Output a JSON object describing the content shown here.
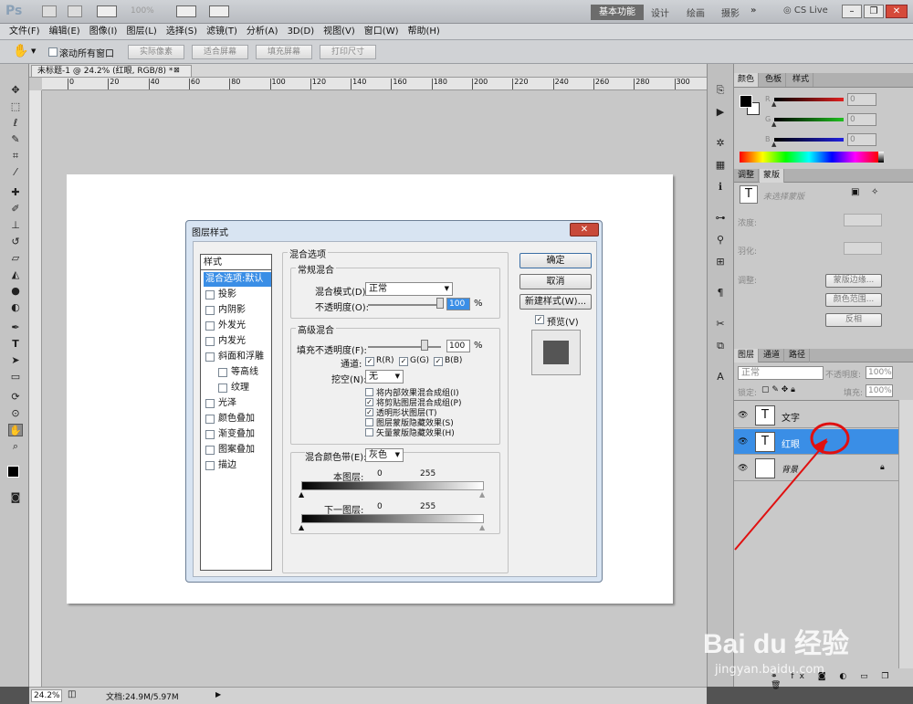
{
  "app": {
    "logo": "Ps",
    "zoom_display": "100%",
    "workspaces": [
      "基本功能",
      "设计",
      "绘画",
      "摄影"
    ],
    "cslive": "CS Live"
  },
  "menu": [
    "文件(F)",
    "编辑(E)",
    "图像(I)",
    "图层(L)",
    "选择(S)",
    "滤镜(T)",
    "分析(A)",
    "3D(D)",
    "视图(V)",
    "窗口(W)",
    "帮助(H)"
  ],
  "options": {
    "scroll_all": "滚动所有窗口",
    "btn1": "实际像素",
    "btn2": "适合屏幕",
    "btn3": "填充屏幕",
    "btn4": "打印尺寸"
  },
  "doc": {
    "tab": "未标题-1 @ 24.2% (红眼, RGB/8) *",
    "ruler": [
      "0",
      "20",
      "40",
      "60",
      "80",
      "100",
      "120",
      "140",
      "160",
      "180",
      "200",
      "220",
      "240",
      "260",
      "280",
      "300"
    ],
    "zoom": "24.2%",
    "status": "文档:24.9M/5.97M"
  },
  "dialog": {
    "title": "图层样式",
    "styles_header": "样式",
    "styles": [
      {
        "label": "混合选项:默认",
        "selected": true,
        "checkbox": false,
        "indent": false
      },
      {
        "label": "投影",
        "checkbox": true,
        "indent": false
      },
      {
        "label": "内阴影",
        "checkbox": true,
        "indent": false
      },
      {
        "label": "外发光",
        "checkbox": true,
        "indent": false
      },
      {
        "label": "内发光",
        "checkbox": true,
        "indent": false
      },
      {
        "label": "斜面和浮雕",
        "checkbox": true,
        "indent": false
      },
      {
        "label": "等高线",
        "checkbox": true,
        "indent": true
      },
      {
        "label": "纹理",
        "checkbox": true,
        "indent": true
      },
      {
        "label": "光泽",
        "checkbox": true,
        "indent": false
      },
      {
        "label": "颜色叠加",
        "checkbox": true,
        "indent": false
      },
      {
        "label": "渐变叠加",
        "checkbox": true,
        "indent": false
      },
      {
        "label": "图案叠加",
        "checkbox": true,
        "indent": false
      },
      {
        "label": "描边",
        "checkbox": true,
        "indent": false
      }
    ],
    "blend_options": "混合选项",
    "general": "常规混合",
    "blend_mode_label": "混合模式(D):",
    "blend_mode": "正常",
    "opacity_label": "不透明度(O):",
    "opacity": "100",
    "pct": "%",
    "advanced": "高级混合",
    "fill_label": "填充不透明度(F):",
    "fill": "100",
    "channels_label": "通道:",
    "ch_r": "R(R)",
    "ch_g": "G(G)",
    "ch_b": "B(B)",
    "knockout_label": "挖空(N):",
    "knockout": "无",
    "options": [
      {
        "label": "将内部效果混合成组(I)",
        "checked": false
      },
      {
        "label": "将剪贴图层混合成组(P)",
        "checked": true
      },
      {
        "label": "透明形状图层(T)",
        "checked": true
      },
      {
        "label": "图层蒙版隐藏效果(S)",
        "checked": false
      },
      {
        "label": "矢量蒙版隐藏效果(H)",
        "checked": false
      }
    ],
    "blend_if_label": "混合颜色带(E):",
    "blend_if": "灰色",
    "this_layer": "本图层:",
    "under_layer": "下一图层:",
    "v0": "0",
    "v255": "255",
    "ok": "确定",
    "cancel": "取消",
    "new_style": "新建样式(W)...",
    "preview": "预览(V)"
  },
  "panels": {
    "color_tabs": [
      "颜色",
      "色板",
      "样式"
    ],
    "rgb": [
      {
        "ch": "R",
        "val": "0",
        "color": "#e02020"
      },
      {
        "ch": "G",
        "val": "0",
        "color": "#20c020"
      },
      {
        "ch": "B",
        "val": "0",
        "color": "#2020e0"
      }
    ],
    "adj_tabs": [
      "调整",
      "蒙版"
    ],
    "mask_hint": "未选择蒙版",
    "density": "浓度:",
    "feather": "羽化:",
    "refine": "调整:",
    "mask_edge": "蒙版边缘...",
    "color_range": "颜色范围...",
    "invert": "反相",
    "layer_tabs": [
      "图层",
      "通道",
      "路径"
    ],
    "blend": "正常",
    "opacity_label": "不透明度:",
    "opacity": "100%",
    "lock_label": "锁定:",
    "fill_label": "填充:",
    "fill": "100%",
    "layers": [
      {
        "name": "文字",
        "type": "T",
        "selected": false
      },
      {
        "name": "红眼",
        "type": "T",
        "selected": true
      },
      {
        "name": "背景",
        "type": "bg",
        "selected": false
      }
    ]
  },
  "watermark": "Bai du 经验",
  "watermark_sub": "jingyan.baidu.com",
  "colors": {
    "selection": "#3a8ee6",
    "annotation": "#e01010"
  }
}
